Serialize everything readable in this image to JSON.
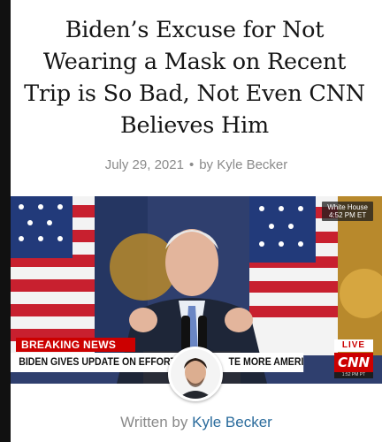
{
  "article": {
    "title": "Biden’s Excuse for Not Wearing a Mask on Recent Trip is So Bad, Not Even CNN Believes Him",
    "date": "July 29, 2021",
    "separator": "•",
    "byline_prefix": "by",
    "author": "Kyle Becker",
    "written_by_label": "Written by"
  },
  "video_overlay": {
    "wh_badge_line1": "White House",
    "wh_badge_line2": "4:52 PM ET",
    "breaking_label": "BREAKING NEWS",
    "ticker_left": "BIDEN GIVES UPDATE ON EFFORT",
    "ticker_right": "TE MORE AMERICANS",
    "live_label": "LIVE",
    "network_logo": "CNN",
    "time_small": "1:52 PM PT"
  },
  "colors": {
    "headline": "#161616",
    "meta_gray": "#8a8a8a",
    "author_link": "#2a6b9c",
    "cnn_red": "#cc0000"
  },
  "icons": {
    "avatar": "author-avatar-photo"
  }
}
